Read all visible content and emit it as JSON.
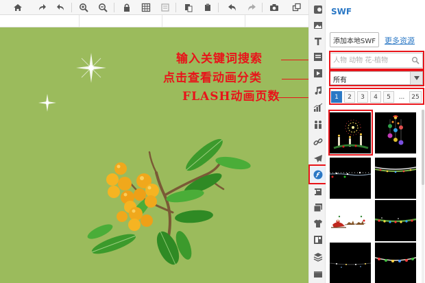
{
  "toolbar": {
    "buttons": [
      "home-icon",
      "redo-icon",
      "undo-icon",
      "zoom-in-icon",
      "zoom-out-icon",
      "lock-icon",
      "grid-icon",
      "frame-icon",
      "paste-icon",
      "copy-icon",
      "arrow-back-icon",
      "arrow-forward-icon",
      "camera-icon",
      "layers-icon"
    ]
  },
  "annotations": {
    "search_hint": "输入关键词搜索",
    "category_hint": "点击查看动画分类",
    "pages_hint": "FLASH动画页数"
  },
  "sidebar": {
    "items": [
      "background-icon",
      "image-icon",
      "text-icon",
      "layout-icon",
      "video-icon",
      "music-icon",
      "chart-icon",
      "people-icon",
      "link-icon",
      "plane-icon",
      "flash-icon",
      "sticker-icon",
      "gallery-icon",
      "shirt-icon",
      "template-icon",
      "layers-stack-icon",
      "box-icon"
    ],
    "active": "flash-icon"
  },
  "panel": {
    "title": "SWF",
    "add_local_label": "添加本地SWF",
    "more_resources_label": "更多资源",
    "search": {
      "placeholder": "人物 动物 花-植物",
      "value": ""
    },
    "category": {
      "selected": "所有"
    },
    "pagination": {
      "pages": [
        "1",
        "2",
        "3",
        "4",
        "5",
        "...",
        "25"
      ],
      "current": "1"
    },
    "thumbnails": [
      {
        "kind": "candles-fireworks"
      },
      {
        "kind": "hanging-ornaments"
      },
      {
        "kind": "sparkle-line"
      },
      {
        "kind": "garland-strip"
      },
      {
        "kind": "santa-sleigh"
      },
      {
        "kind": "christmas-lights"
      },
      {
        "kind": "dark-sparkles"
      },
      {
        "kind": "colored-bulbs"
      }
    ]
  },
  "colors": {
    "canvas_bg": "#9bbb5c",
    "accent": "#2b78c5",
    "annotation_red": "#e8141a"
  }
}
